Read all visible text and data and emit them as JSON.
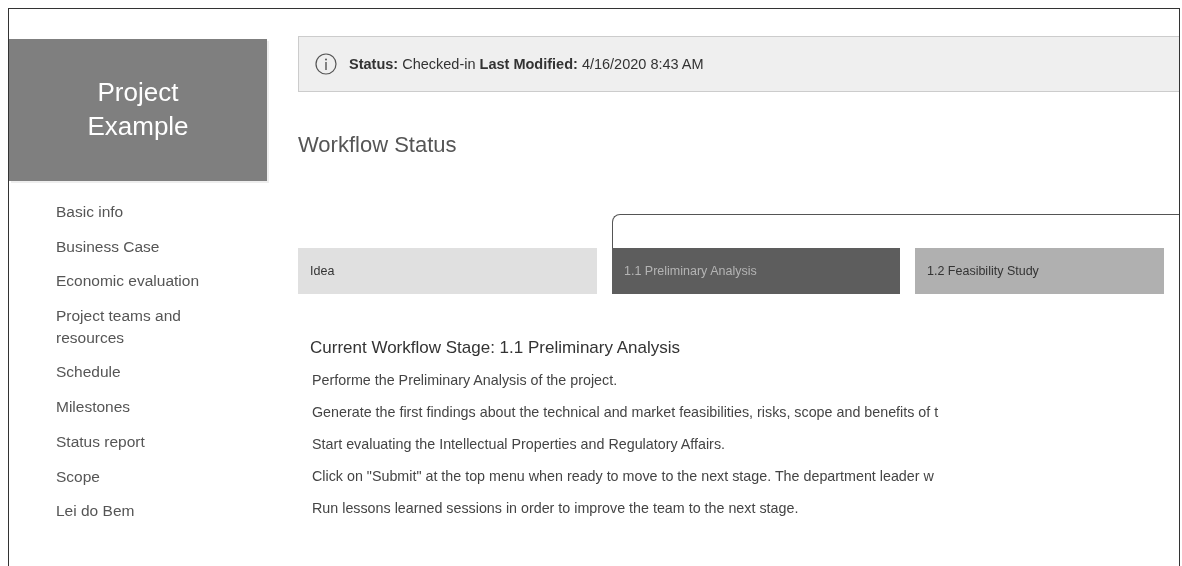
{
  "sidebar": {
    "title": "Project Example",
    "items": [
      "Basic info",
      "Business Case",
      "Economic evaluation",
      "Project teams and resources",
      "Schedule",
      "Milestones",
      "Status report",
      "Scope",
      "Lei do Bem"
    ]
  },
  "status_bar": {
    "status_label": "Status:",
    "status": "Checked-in",
    "modified_label": "Last Modified:",
    "modified": "4/16/2020 8:43 AM"
  },
  "heading": "Workflow Status",
  "stages": [
    {
      "label": "Idea",
      "selected": false
    },
    {
      "label": "1.1 Preliminary Analysis",
      "selected": true
    },
    {
      "label": "1.2 Feasibility Study",
      "selected": false
    }
  ],
  "current_stage": "Current Workflow Stage: 1.1 Preliminary Analysis",
  "instructions": [
    "Performe the Preliminary Analysis of the project.",
    "Generate the first findings about the technical and market feasibilities, risks, scope and benefits of t",
    "Start evaluating the Intellectual Properties and Regulatory Affairs.",
    "Click on \"Submit\" at the top menu when ready to move to the next stage. The department leader w",
    "Run lessons learned sessions in order to improve the team to the next stage."
  ]
}
